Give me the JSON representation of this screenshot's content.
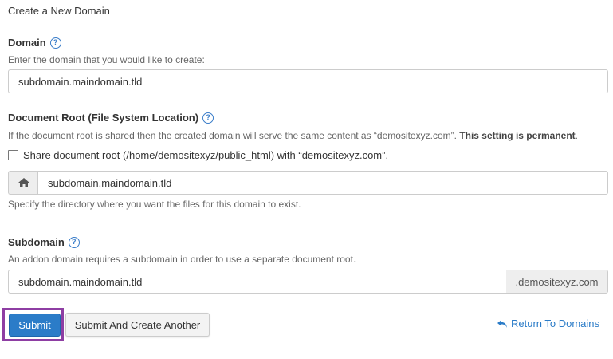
{
  "page": {
    "title": "Create a New Domain"
  },
  "domain": {
    "label": "Domain",
    "description": "Enter the domain that you would like to create:",
    "value": "subdomain.maindomain.tld"
  },
  "document_root": {
    "label": "Document Root (File System Location)",
    "description": "If the document root is shared then the created domain will serve the same content as “demositexyz.com”.",
    "description_bold": "This setting is permanent",
    "description_end": ".",
    "checkbox_label": "Share document root (/home/demositexyz/public_html) with “demositexyz.com”.",
    "checkbox_checked": false,
    "value": "subdomain.maindomain.tld",
    "hint": "Specify the directory where you want the files for this domain to exist."
  },
  "subdomain": {
    "label": "Subdomain",
    "description": "An addon domain requires a subdomain in order to use a separate document root.",
    "value": "subdomain.maindomain.tld",
    "suffix": ".demositexyz.com"
  },
  "actions": {
    "submit_label": "Submit",
    "submit_another_label": "Submit And Create Another",
    "return_label": "Return To Domains"
  },
  "icons": {
    "help": "?",
    "home": "home-icon",
    "return": "return-arrow-icon"
  },
  "colors": {
    "accent": "#2b7cc8",
    "highlight": "#8e3ea3"
  }
}
